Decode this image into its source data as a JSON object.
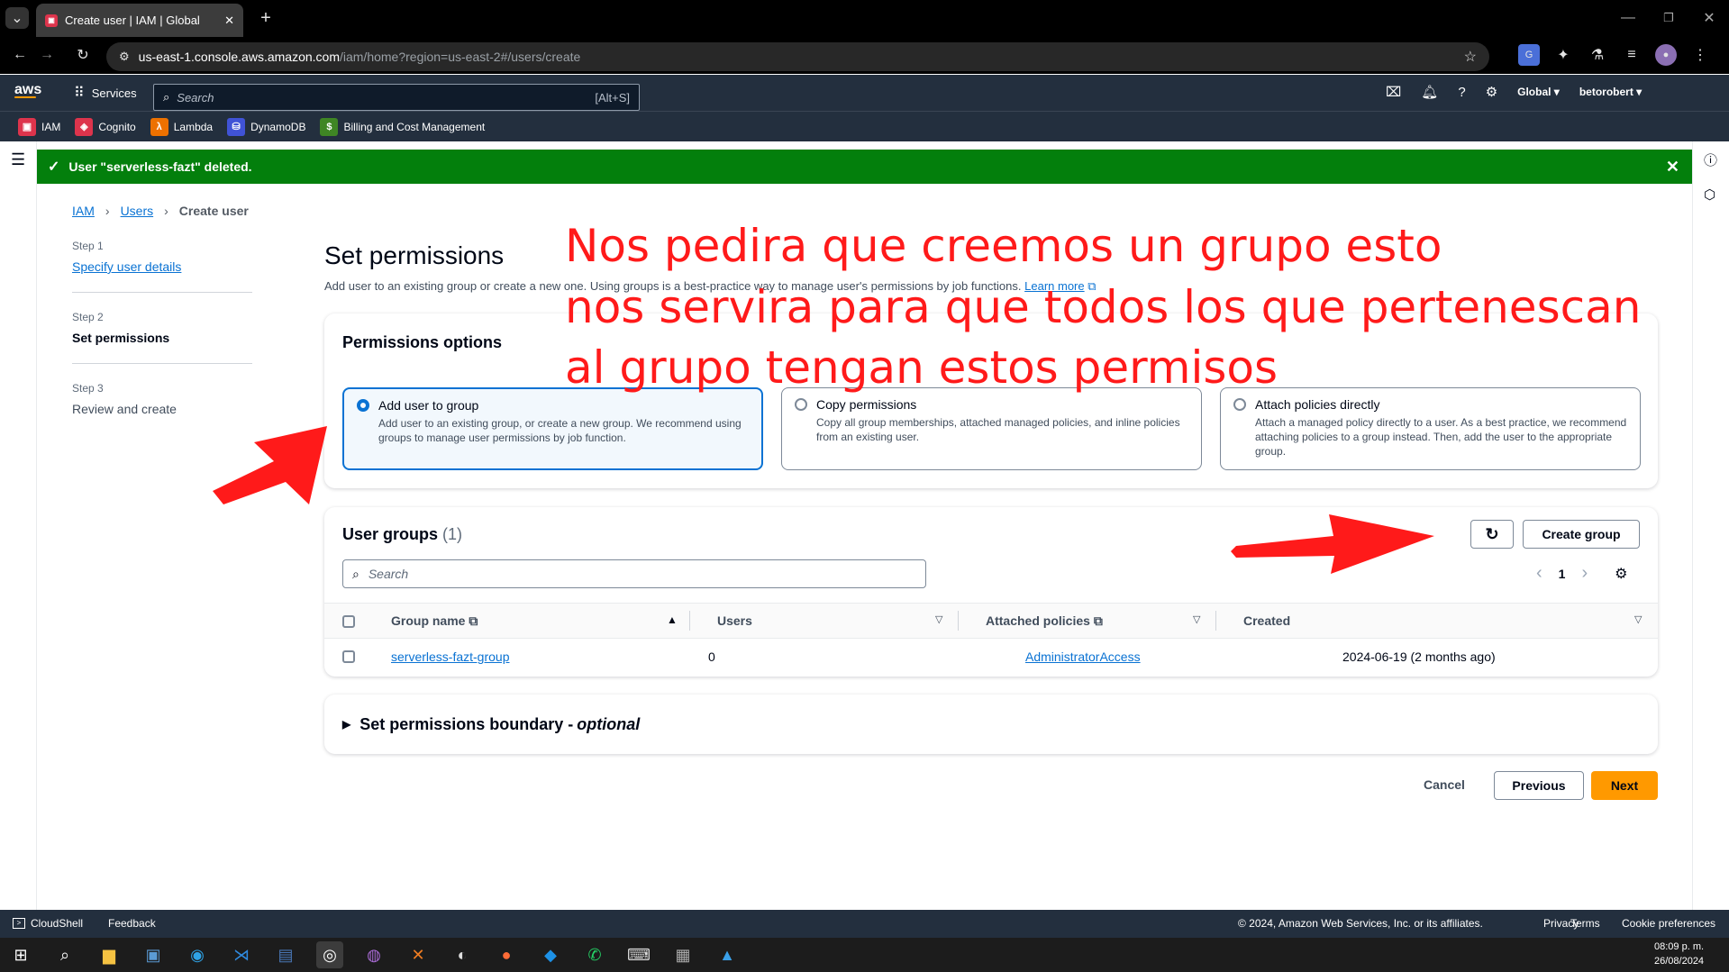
{
  "browser": {
    "tab_title": "Create user | IAM | Global",
    "url_host": "us-east-1.console.aws.amazon.com",
    "url_path": "/iam/home?region=us-east-2#/users/create"
  },
  "aws_nav": {
    "services": "Services",
    "search_placeholder": "Search",
    "search_shortcut": "[Alt+S]",
    "region": "Global ▾",
    "account": "betorobert ▾"
  },
  "favorites": [
    "IAM",
    "Cognito",
    "Lambda",
    "DynamoDB",
    "Billing and Cost Management"
  ],
  "flash": {
    "message": "User \"serverless-fazt\" deleted."
  },
  "breadcrumb": {
    "root": "IAM",
    "parent": "Users",
    "current": "Create user"
  },
  "steps": [
    {
      "num": "Step 1",
      "label": "Specify user details"
    },
    {
      "num": "Step 2",
      "label": "Set permissions"
    },
    {
      "num": "Step 3",
      "label": "Review and create"
    }
  ],
  "page": {
    "title": "Set permissions",
    "description": "Add user to an existing group or create a new one. Using groups is a best-practice way to manage user's permissions by job functions.",
    "learn_more": "Learn more"
  },
  "permissions": {
    "heading": "Permissions options",
    "options": [
      {
        "title": "Add user to group",
        "desc": "Add user to an existing group, or create a new group. We recommend using groups to manage user permissions by job function."
      },
      {
        "title": "Copy permissions",
        "desc": "Copy all group memberships, attached managed policies, and inline policies from an existing user."
      },
      {
        "title": "Attach policies directly",
        "desc": "Attach a managed policy directly to a user. As a best practice, we recommend attaching policies to a group instead. Then, add the user to the appropriate group."
      }
    ]
  },
  "groups": {
    "heading": "User groups",
    "count": "(1)",
    "create_button": "Create group",
    "search_placeholder": "Search",
    "page": "1",
    "columns": [
      "Group name",
      "Users",
      "Attached policies",
      "Created"
    ],
    "rows": [
      {
        "name": "serverless-fazt-group",
        "users": "0",
        "policies": "AdministratorAccess",
        "created": "2024-06-19 (2 months ago)"
      }
    ]
  },
  "boundary": {
    "label": "Set permissions boundary - ",
    "optional": "optional"
  },
  "actions": {
    "cancel": "Cancel",
    "previous": "Previous",
    "next": "Next"
  },
  "annotation": {
    "line1": "Nos pedira que creemos un grupo esto",
    "line2": "nos servira para que todos los que pertenescan",
    "line3": "al grupo tengan estos permisos"
  },
  "footer": {
    "cloudshell": "CloudShell",
    "feedback": "Feedback",
    "copyright": "© 2024, Amazon Web Services, Inc. or its affiliates.",
    "privacy": "Privacy",
    "terms": "Terms",
    "cookies": "Cookie preferences"
  },
  "taskbar": {
    "time": "08:09 p. m.",
    "date": "26/08/2024"
  },
  "colors": {
    "aws_nav": "#232f3e",
    "success": "#037f0c",
    "link": "#0972d3",
    "primary": "#ff9900",
    "annotation": "#ff1a1a"
  }
}
